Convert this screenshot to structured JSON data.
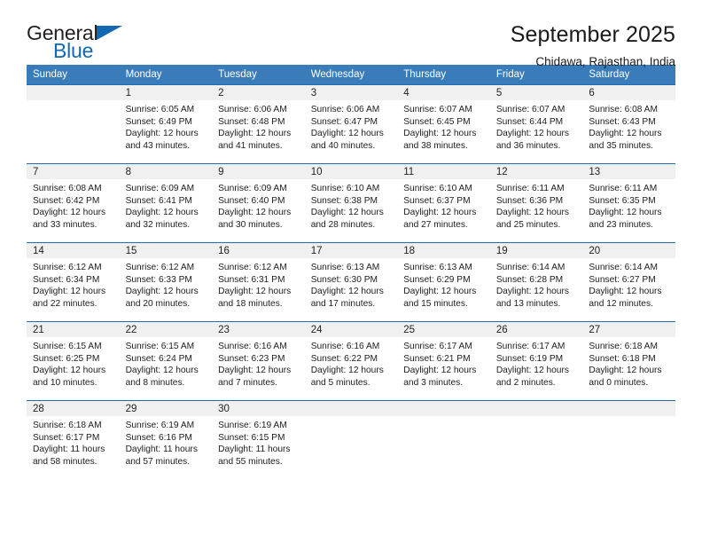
{
  "brand": {
    "word_one": "General",
    "word_two": "Blue",
    "triangle_icon": "blue-triangle-icon",
    "accent_color": "#1268b3"
  },
  "header": {
    "title": "September 2025",
    "subtitle": "Chidawa, Rajasthan, India"
  },
  "theme": {
    "header_blue": "#3a7cba",
    "row_rule_blue": "#1f6cb0",
    "daynum_band": "#f0f0f0"
  },
  "calendar": {
    "weekday_headers": [
      "Sunday",
      "Monday",
      "Tuesday",
      "Wednesday",
      "Thursday",
      "Friday",
      "Saturday"
    ],
    "weeks": [
      [
        {
          "day": "",
          "sunrise": "",
          "sunset": "",
          "daylight_line1": "",
          "daylight_line2": ""
        },
        {
          "day": "1",
          "sunrise": "Sunrise: 6:05 AM",
          "sunset": "Sunset: 6:49 PM",
          "daylight_line1": "Daylight: 12 hours",
          "daylight_line2": "and 43 minutes."
        },
        {
          "day": "2",
          "sunrise": "Sunrise: 6:06 AM",
          "sunset": "Sunset: 6:48 PM",
          "daylight_line1": "Daylight: 12 hours",
          "daylight_line2": "and 41 minutes."
        },
        {
          "day": "3",
          "sunrise": "Sunrise: 6:06 AM",
          "sunset": "Sunset: 6:47 PM",
          "daylight_line1": "Daylight: 12 hours",
          "daylight_line2": "and 40 minutes."
        },
        {
          "day": "4",
          "sunrise": "Sunrise: 6:07 AM",
          "sunset": "Sunset: 6:45 PM",
          "daylight_line1": "Daylight: 12 hours",
          "daylight_line2": "and 38 minutes."
        },
        {
          "day": "5",
          "sunrise": "Sunrise: 6:07 AM",
          "sunset": "Sunset: 6:44 PM",
          "daylight_line1": "Daylight: 12 hours",
          "daylight_line2": "and 36 minutes."
        },
        {
          "day": "6",
          "sunrise": "Sunrise: 6:08 AM",
          "sunset": "Sunset: 6:43 PM",
          "daylight_line1": "Daylight: 12 hours",
          "daylight_line2": "and 35 minutes."
        }
      ],
      [
        {
          "day": "7",
          "sunrise": "Sunrise: 6:08 AM",
          "sunset": "Sunset: 6:42 PM",
          "daylight_line1": "Daylight: 12 hours",
          "daylight_line2": "and 33 minutes."
        },
        {
          "day": "8",
          "sunrise": "Sunrise: 6:09 AM",
          "sunset": "Sunset: 6:41 PM",
          "daylight_line1": "Daylight: 12 hours",
          "daylight_line2": "and 32 minutes."
        },
        {
          "day": "9",
          "sunrise": "Sunrise: 6:09 AM",
          "sunset": "Sunset: 6:40 PM",
          "daylight_line1": "Daylight: 12 hours",
          "daylight_line2": "and 30 minutes."
        },
        {
          "day": "10",
          "sunrise": "Sunrise: 6:10 AM",
          "sunset": "Sunset: 6:38 PM",
          "daylight_line1": "Daylight: 12 hours",
          "daylight_line2": "and 28 minutes."
        },
        {
          "day": "11",
          "sunrise": "Sunrise: 6:10 AM",
          "sunset": "Sunset: 6:37 PM",
          "daylight_line1": "Daylight: 12 hours",
          "daylight_line2": "and 27 minutes."
        },
        {
          "day": "12",
          "sunrise": "Sunrise: 6:11 AM",
          "sunset": "Sunset: 6:36 PM",
          "daylight_line1": "Daylight: 12 hours",
          "daylight_line2": "and 25 minutes."
        },
        {
          "day": "13",
          "sunrise": "Sunrise: 6:11 AM",
          "sunset": "Sunset: 6:35 PM",
          "daylight_line1": "Daylight: 12 hours",
          "daylight_line2": "and 23 minutes."
        }
      ],
      [
        {
          "day": "14",
          "sunrise": "Sunrise: 6:12 AM",
          "sunset": "Sunset: 6:34 PM",
          "daylight_line1": "Daylight: 12 hours",
          "daylight_line2": "and 22 minutes."
        },
        {
          "day": "15",
          "sunrise": "Sunrise: 6:12 AM",
          "sunset": "Sunset: 6:33 PM",
          "daylight_line1": "Daylight: 12 hours",
          "daylight_line2": "and 20 minutes."
        },
        {
          "day": "16",
          "sunrise": "Sunrise: 6:12 AM",
          "sunset": "Sunset: 6:31 PM",
          "daylight_line1": "Daylight: 12 hours",
          "daylight_line2": "and 18 minutes."
        },
        {
          "day": "17",
          "sunrise": "Sunrise: 6:13 AM",
          "sunset": "Sunset: 6:30 PM",
          "daylight_line1": "Daylight: 12 hours",
          "daylight_line2": "and 17 minutes."
        },
        {
          "day": "18",
          "sunrise": "Sunrise: 6:13 AM",
          "sunset": "Sunset: 6:29 PM",
          "daylight_line1": "Daylight: 12 hours",
          "daylight_line2": "and 15 minutes."
        },
        {
          "day": "19",
          "sunrise": "Sunrise: 6:14 AM",
          "sunset": "Sunset: 6:28 PM",
          "daylight_line1": "Daylight: 12 hours",
          "daylight_line2": "and 13 minutes."
        },
        {
          "day": "20",
          "sunrise": "Sunrise: 6:14 AM",
          "sunset": "Sunset: 6:27 PM",
          "daylight_line1": "Daylight: 12 hours",
          "daylight_line2": "and 12 minutes."
        }
      ],
      [
        {
          "day": "21",
          "sunrise": "Sunrise: 6:15 AM",
          "sunset": "Sunset: 6:25 PM",
          "daylight_line1": "Daylight: 12 hours",
          "daylight_line2": "and 10 minutes."
        },
        {
          "day": "22",
          "sunrise": "Sunrise: 6:15 AM",
          "sunset": "Sunset: 6:24 PM",
          "daylight_line1": "Daylight: 12 hours",
          "daylight_line2": "and 8 minutes."
        },
        {
          "day": "23",
          "sunrise": "Sunrise: 6:16 AM",
          "sunset": "Sunset: 6:23 PM",
          "daylight_line1": "Daylight: 12 hours",
          "daylight_line2": "and 7 minutes."
        },
        {
          "day": "24",
          "sunrise": "Sunrise: 6:16 AM",
          "sunset": "Sunset: 6:22 PM",
          "daylight_line1": "Daylight: 12 hours",
          "daylight_line2": "and 5 minutes."
        },
        {
          "day": "25",
          "sunrise": "Sunrise: 6:17 AM",
          "sunset": "Sunset: 6:21 PM",
          "daylight_line1": "Daylight: 12 hours",
          "daylight_line2": "and 3 minutes."
        },
        {
          "day": "26",
          "sunrise": "Sunrise: 6:17 AM",
          "sunset": "Sunset: 6:19 PM",
          "daylight_line1": "Daylight: 12 hours",
          "daylight_line2": "and 2 minutes."
        },
        {
          "day": "27",
          "sunrise": "Sunrise: 6:18 AM",
          "sunset": "Sunset: 6:18 PM",
          "daylight_line1": "Daylight: 12 hours",
          "daylight_line2": "and 0 minutes."
        }
      ],
      [
        {
          "day": "28",
          "sunrise": "Sunrise: 6:18 AM",
          "sunset": "Sunset: 6:17 PM",
          "daylight_line1": "Daylight: 11 hours",
          "daylight_line2": "and 58 minutes."
        },
        {
          "day": "29",
          "sunrise": "Sunrise: 6:19 AM",
          "sunset": "Sunset: 6:16 PM",
          "daylight_line1": "Daylight: 11 hours",
          "daylight_line2": "and 57 minutes."
        },
        {
          "day": "30",
          "sunrise": "Sunrise: 6:19 AM",
          "sunset": "Sunset: 6:15 PM",
          "daylight_line1": "Daylight: 11 hours",
          "daylight_line2": "and 55 minutes."
        },
        {
          "day": "",
          "sunrise": "",
          "sunset": "",
          "daylight_line1": "",
          "daylight_line2": ""
        },
        {
          "day": "",
          "sunrise": "",
          "sunset": "",
          "daylight_line1": "",
          "daylight_line2": ""
        },
        {
          "day": "",
          "sunrise": "",
          "sunset": "",
          "daylight_line1": "",
          "daylight_line2": ""
        },
        {
          "day": "",
          "sunrise": "",
          "sunset": "",
          "daylight_line1": "",
          "daylight_line2": ""
        }
      ]
    ]
  }
}
